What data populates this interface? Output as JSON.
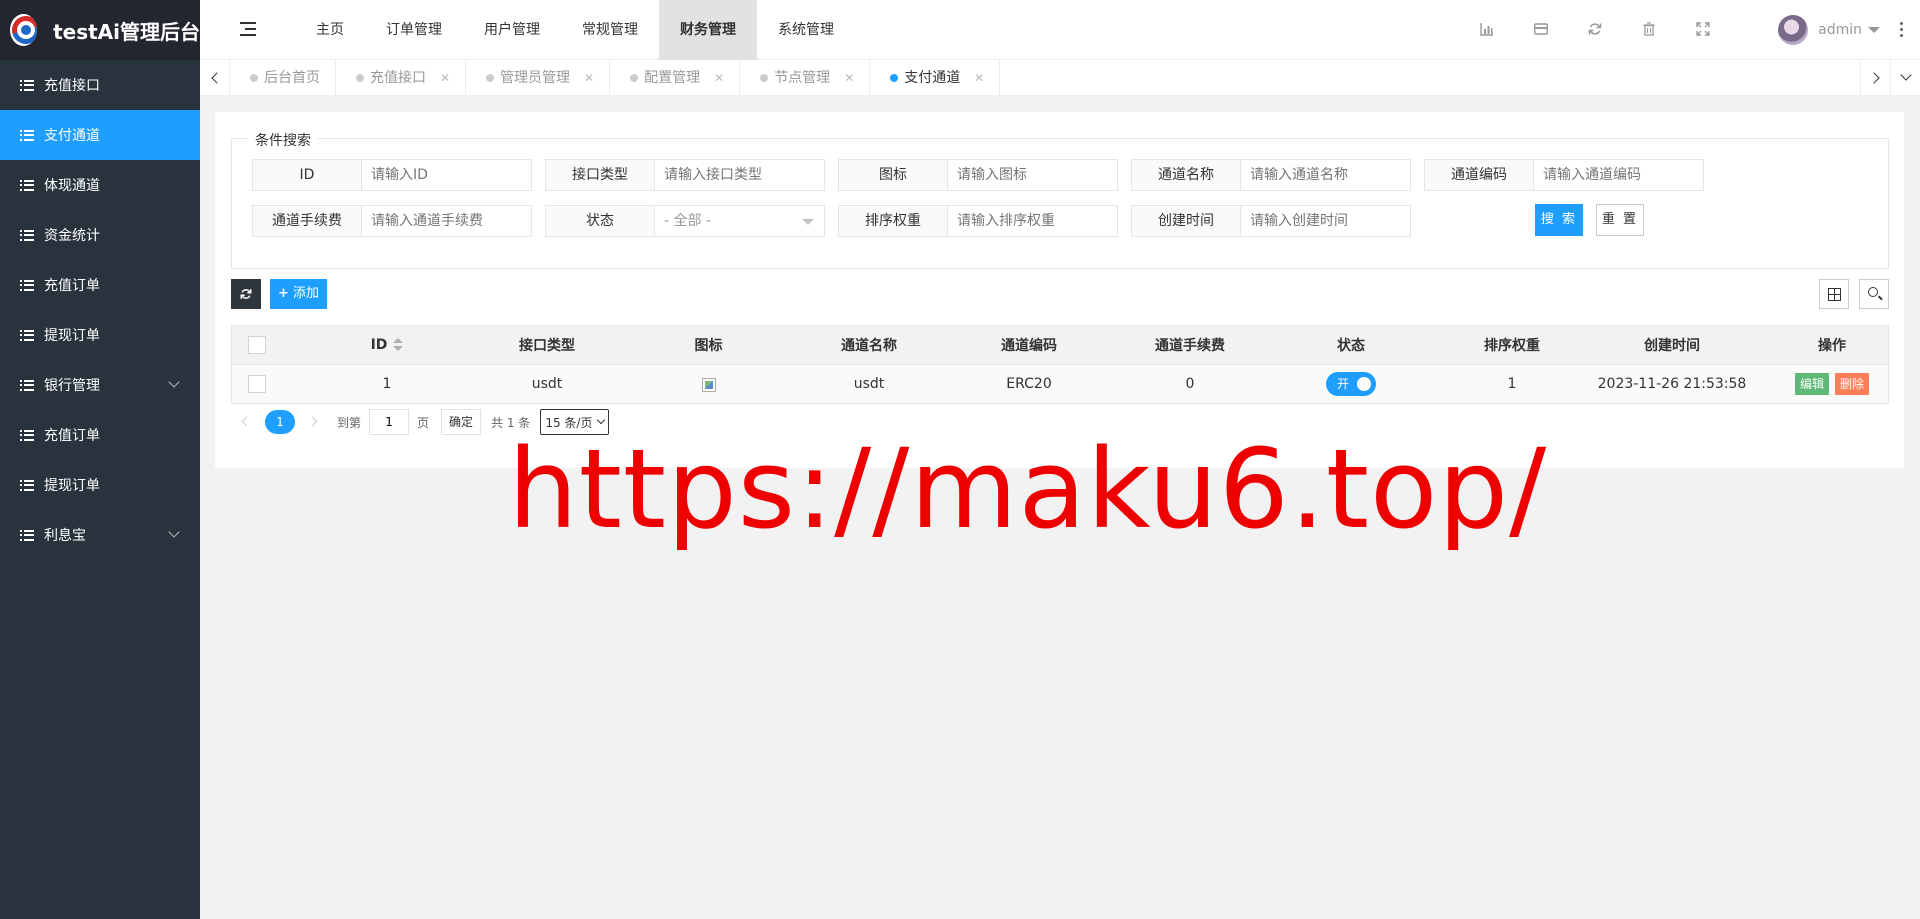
{
  "app": {
    "title": "testAi管理后台"
  },
  "sidebar": {
    "items": [
      {
        "label": "充值接口"
      },
      {
        "label": "支付通道"
      },
      {
        "label": "体现通道"
      },
      {
        "label": "资金统计"
      },
      {
        "label": "充值订单"
      },
      {
        "label": "提现订单"
      },
      {
        "label": "银行管理"
      },
      {
        "label": "充值订单"
      },
      {
        "label": "提现订单"
      },
      {
        "label": "利息宝"
      }
    ],
    "active_index": 1,
    "accent": "#1e9fff"
  },
  "header": {
    "nav": [
      {
        "label": "主页"
      },
      {
        "label": "订单管理"
      },
      {
        "label": "用户管理"
      },
      {
        "label": "常规管理"
      },
      {
        "label": "财务管理"
      },
      {
        "label": "系统管理"
      }
    ],
    "active_nav": "财务管理",
    "icons": [
      "chart-icon",
      "card-icon",
      "refresh-icon",
      "trash-icon",
      "fullscreen-icon"
    ],
    "username": "admin"
  },
  "tabs": [
    {
      "label": "后台首页",
      "closable": false
    },
    {
      "label": "充值接口",
      "closable": true
    },
    {
      "label": "管理员管理",
      "closable": true
    },
    {
      "label": "配置管理",
      "closable": true
    },
    {
      "label": "节点管理",
      "closable": true
    },
    {
      "label": "支付通道",
      "closable": true
    }
  ],
  "active_tab": "支付通道",
  "search": {
    "legend": "条件搜索",
    "fields": [
      {
        "label": "ID",
        "placeholder": "请输入ID"
      },
      {
        "label": "接口类型",
        "placeholder": "请输入接口类型"
      },
      {
        "label": "图标",
        "placeholder": "请输入图标"
      },
      {
        "label": "通道名称",
        "placeholder": "请输入通道名称"
      },
      {
        "label": "通道编码",
        "placeholder": "请输入通道编码"
      },
      {
        "label": "通道手续费",
        "placeholder": "请输入通道手续费"
      },
      {
        "label": "状态",
        "selected": "- 全部 -"
      },
      {
        "label": "排序权重",
        "placeholder": "请输入排序权重"
      },
      {
        "label": "创建时间",
        "placeholder": "请输入创建时间"
      }
    ],
    "search_button": "搜 索",
    "reset_button": "重 置"
  },
  "toolbar": {
    "add_label": "添加"
  },
  "table": {
    "columns": [
      "ID",
      "接口类型",
      "图标",
      "通道名称",
      "通道编码",
      "通道手续费",
      "状态",
      "排序权重",
      "创建时间",
      "操作"
    ],
    "rows": [
      {
        "id": "1",
        "interface_type": "usdt",
        "icon": "broken-image",
        "channel_name": "usdt",
        "channel_code": "ERC20",
        "fee": "0",
        "status_label": "开",
        "status_on": true,
        "sort_weight": "1",
        "created_at": "2023-11-26 21:53:58",
        "edit_label": "编辑",
        "delete_label": "删除"
      }
    ]
  },
  "pager": {
    "current_page": "1",
    "goto_prefix": "到第",
    "goto_value": "1",
    "goto_suffix": "页",
    "confirm_label": "确定",
    "total_text": "共 1 条",
    "per_page": "15 条/页"
  },
  "watermark": {
    "text": "https://maku6.top/",
    "color": "#ee0000"
  }
}
